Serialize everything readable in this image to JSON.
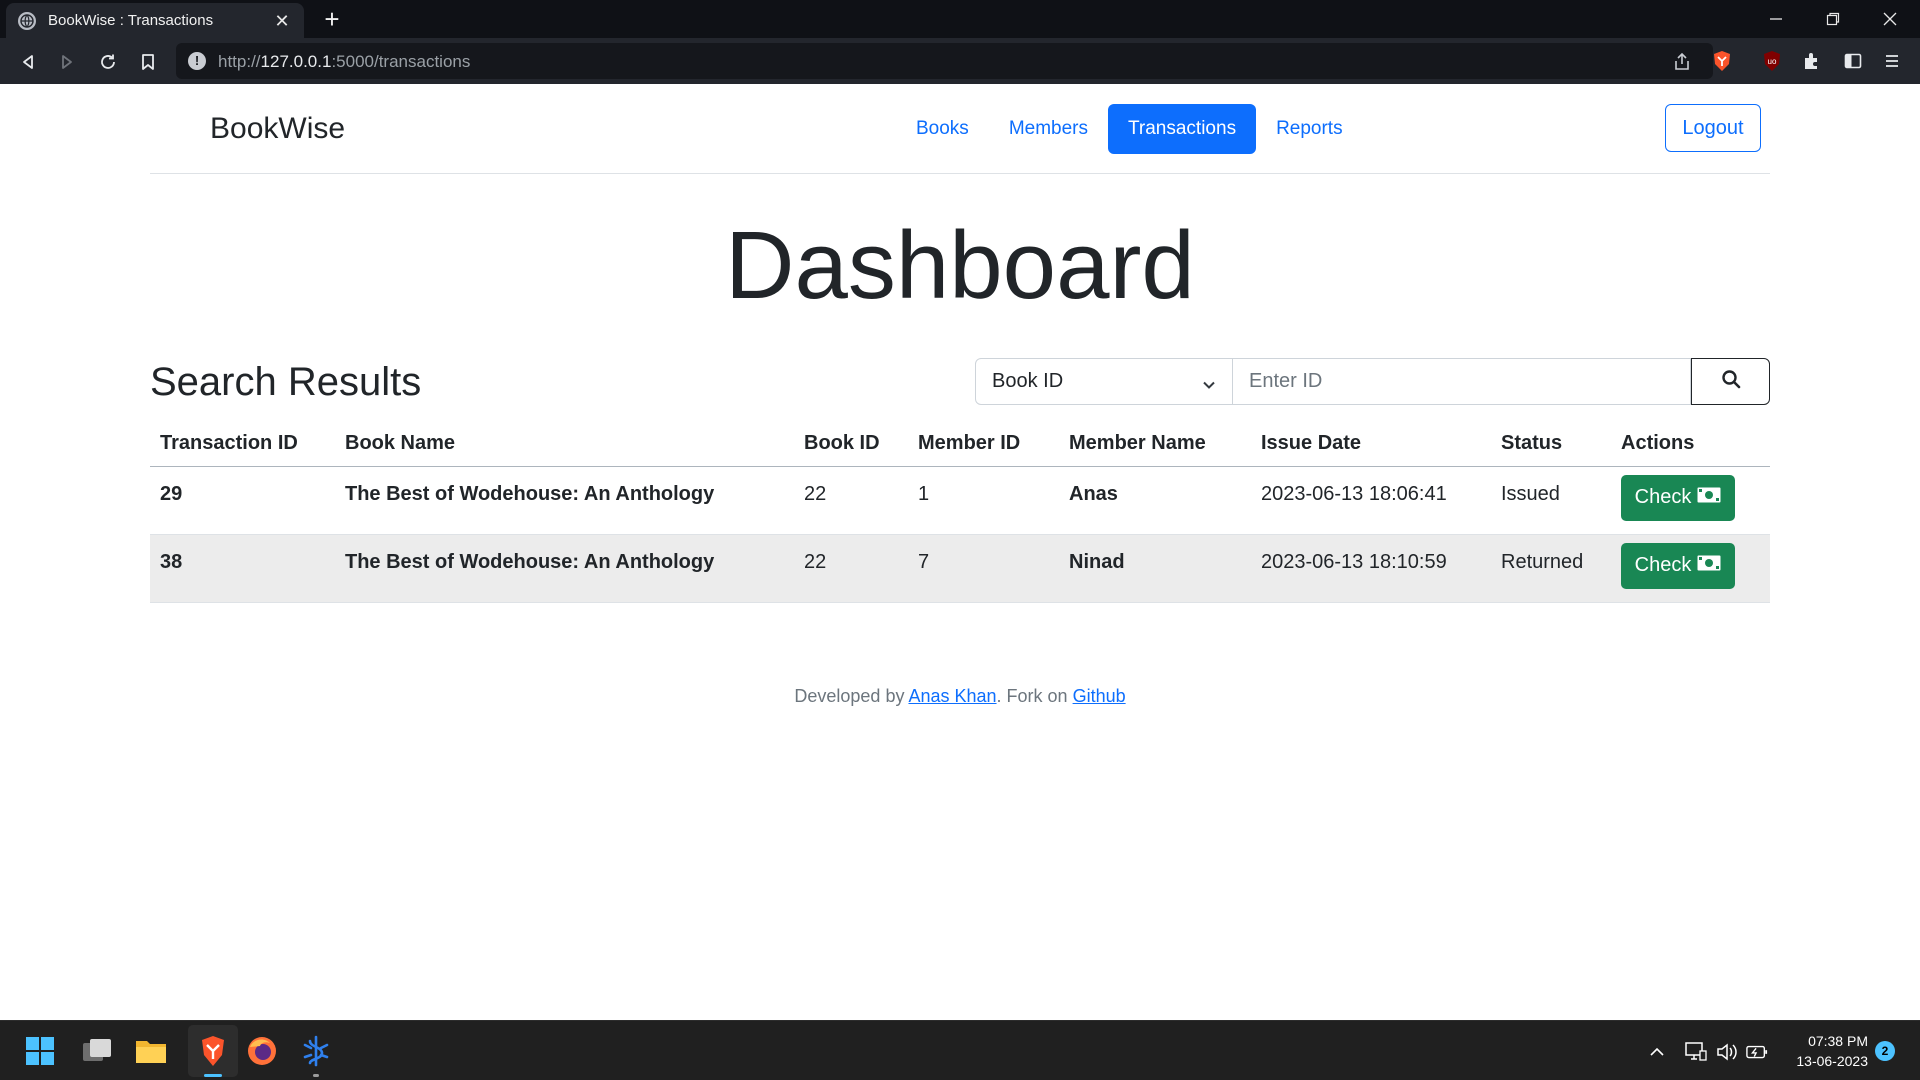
{
  "browser": {
    "tab_title": "BookWise : Transactions",
    "url_scheme": "http://",
    "url_host": "127.0.0.1",
    "url_rest": ":5000/transactions"
  },
  "navbar": {
    "brand": "BookWise",
    "links": [
      {
        "label": "Books",
        "active": false
      },
      {
        "label": "Members",
        "active": false
      },
      {
        "label": "Transactions",
        "active": true
      },
      {
        "label": "Reports",
        "active": false
      }
    ],
    "logout_label": "Logout"
  },
  "main": {
    "heading": "Dashboard",
    "results_title": "Search Results",
    "search": {
      "select_value": "Book ID",
      "input_placeholder": "Enter ID",
      "input_value": ""
    },
    "table": {
      "headers": [
        "Transaction ID",
        "Book Name",
        "Book ID",
        "Member ID",
        "Member Name",
        "Issue Date",
        "Status",
        "Actions"
      ],
      "rows": [
        {
          "transaction_id": "29",
          "book_name": "The Best of Wodehouse: An Anthology",
          "book_id": "22",
          "member_id": "1",
          "member_name": "Anas",
          "issue_date": "2023-06-13 18:06:41",
          "status": "Issued",
          "action_label": "Check"
        },
        {
          "transaction_id": "38",
          "book_name": "The Best of Wodehouse: An Anthology",
          "book_id": "22",
          "member_id": "7",
          "member_name": "Ninad",
          "issue_date": "2023-06-13 18:10:59",
          "status": "Returned",
          "action_label": "Check"
        }
      ]
    }
  },
  "footer": {
    "prefix": "Developed by ",
    "author_link": "Anas Khan",
    "middle": ". Fork on ",
    "repo_link": "Github"
  },
  "taskbar": {
    "time": "07:38 PM",
    "date": "13-06-2023",
    "notification_count": "2"
  },
  "colors": {
    "primary": "#0d6efd",
    "success": "#198754",
    "browser_frame": "#0f1116",
    "browser_toolbar": "#23262d",
    "taskbar": "#202020"
  }
}
